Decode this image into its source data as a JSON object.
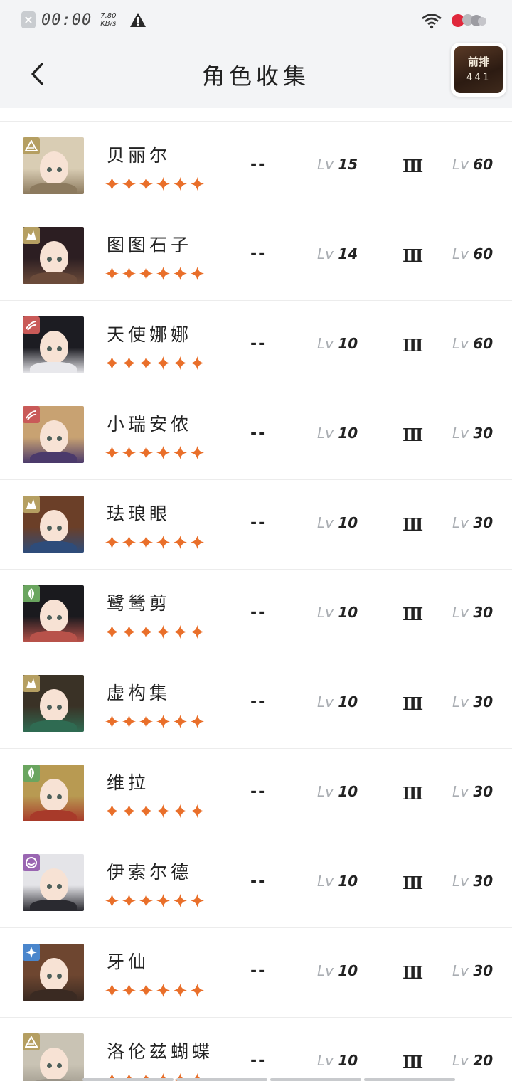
{
  "status_bar": {
    "time": "00:00",
    "speed_value": "7.80",
    "speed_unit": "KB/s"
  },
  "header": {
    "title": "角色收集",
    "badge_line1": "前排",
    "badge_line2": "441"
  },
  "colors": {
    "star": "#e96f2a",
    "class_gold": "#b59f62",
    "class_red": "#c95a58",
    "class_green": "#6aa55f",
    "class_purple": "#9a66b2",
    "class_blue": "#4a86cc"
  },
  "characters": [
    {
      "name": "贝丽尔",
      "col2": "--",
      "lv_prefix": "Lv",
      "level": "15",
      "rank": "Ⅲ",
      "max_prefix": "Lv",
      "max_level": "60",
      "stars": 6,
      "class_icon": "mountain-icon",
      "class_color": "#b59f62",
      "hair": "#d9cdb4",
      "collar": "#8c7a5e"
    },
    {
      "name": "图图石子",
      "col2": "--",
      "lv_prefix": "Lv",
      "level": "14",
      "rank": "Ⅲ",
      "max_prefix": "Lv",
      "max_level": "60",
      "stars": 6,
      "class_icon": "rock-icon",
      "class_color": "#b59f62",
      "hair": "#2c1e22",
      "collar": "#6b4b3a"
    },
    {
      "name": "天使娜娜",
      "col2": "--",
      "lv_prefix": "Lv",
      "level": "10",
      "rank": "Ⅲ",
      "max_prefix": "Lv",
      "max_level": "60",
      "stars": 6,
      "class_icon": "wind-icon",
      "class_color": "#c95a58",
      "hair": "#1c1c22",
      "collar": "#e8e8ec"
    },
    {
      "name": "小瑞安侬",
      "col2": "--",
      "lv_prefix": "Lv",
      "level": "10",
      "rank": "Ⅲ",
      "max_prefix": "Lv",
      "max_level": "30",
      "stars": 6,
      "class_icon": "wind-icon",
      "class_color": "#c95a58",
      "hair": "#c8a272",
      "collar": "#4b3a6b"
    },
    {
      "name": "珐琅眼",
      "col2": "--",
      "lv_prefix": "Lv",
      "level": "10",
      "rank": "Ⅲ",
      "max_prefix": "Lv",
      "max_level": "30",
      "stars": 6,
      "class_icon": "rock-icon",
      "class_color": "#b59f62",
      "hair": "#6b3f28",
      "collar": "#2e4c7a"
    },
    {
      "name": "鹭鸶剪",
      "col2": "--",
      "lv_prefix": "Lv",
      "level": "10",
      "rank": "Ⅲ",
      "max_prefix": "Lv",
      "max_level": "30",
      "stars": 6,
      "class_icon": "leaf-icon",
      "class_color": "#6aa55f",
      "hair": "#1a1a1e",
      "collar": "#b8524a"
    },
    {
      "name": "虚构集",
      "col2": "--",
      "lv_prefix": "Lv",
      "level": "10",
      "rank": "Ⅲ",
      "max_prefix": "Lv",
      "max_level": "30",
      "stars": 6,
      "class_icon": "rock-icon",
      "class_color": "#b59f62",
      "hair": "#3a3226",
      "collar": "#2f6b52"
    },
    {
      "name": "维拉",
      "col2": "--",
      "lv_prefix": "Lv",
      "level": "10",
      "rank": "Ⅲ",
      "max_prefix": "Lv",
      "max_level": "30",
      "stars": 6,
      "class_icon": "leaf-icon",
      "class_color": "#6aa55f",
      "hair": "#b89a52",
      "collar": "#a83a2a"
    },
    {
      "name": "伊索尔德",
      "col2": "--",
      "lv_prefix": "Lv",
      "level": "10",
      "rank": "Ⅲ",
      "max_prefix": "Lv",
      "max_level": "30",
      "stars": 6,
      "class_icon": "moon-icon",
      "class_color": "#9a66b2",
      "hair": "#e4e4e8",
      "collar": "#2a2a30"
    },
    {
      "name": "牙仙",
      "col2": "--",
      "lv_prefix": "Lv",
      "level": "10",
      "rank": "Ⅲ",
      "max_prefix": "Lv",
      "max_level": "30",
      "stars": 6,
      "class_icon": "star-burst-icon",
      "class_color": "#4a86cc",
      "hair": "#6e4630",
      "collar": "#3a2a22"
    },
    {
      "name": "洛伦兹蝴蝶",
      "col2": "--",
      "lv_prefix": "Lv",
      "level": "10",
      "rank": "Ⅲ",
      "max_prefix": "Lv",
      "max_level": "20",
      "stars": 6,
      "class_icon": "mountain-icon",
      "class_color": "#b59f62",
      "hair": "#c9c3b4",
      "collar": "#9a9488"
    }
  ]
}
